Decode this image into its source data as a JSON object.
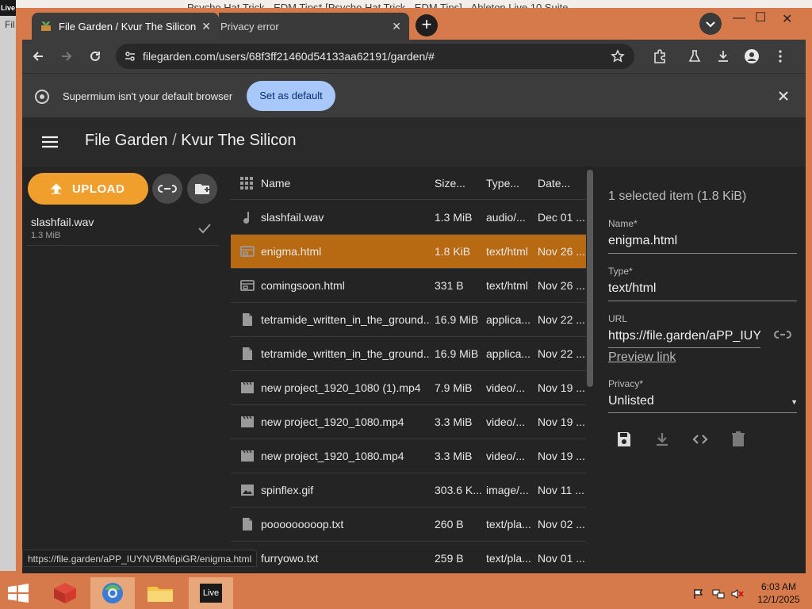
{
  "background": {
    "window_title": "Psycho Hat Trick - EDM Tips* [Psycho Hat Trick - EDM Tips] - Ableton Live 10 Suite",
    "live_label": "Live",
    "left_menu_hint": "Fil"
  },
  "browser": {
    "tabs": [
      {
        "label": "File Garden / Kvur The Silicon",
        "active": true
      },
      {
        "label": "Privacy error",
        "active": false
      }
    ],
    "address": "filegarden.com/users/68f3ff21460d54133aa62191/garden/#",
    "infobar": {
      "message": "Supermium isn't your default browser",
      "button": "Set as default"
    },
    "status_url": "https://file.garden/aPP_IUYNVBM6piGR/enigma.html"
  },
  "app": {
    "title": "File Garden",
    "separator": "/",
    "user": "Kvur The Silicon",
    "upload_label": "UPLOAD",
    "upload_queue": [
      {
        "name": "slashfail.wav",
        "size": "1.3 MiB"
      }
    ],
    "columns": {
      "name": "Name",
      "size": "Size...",
      "type": "Type...",
      "date": "Date..."
    },
    "files": [
      {
        "icon": "audio-icon",
        "name": "slashfail.wav",
        "size": "1.3 MiB",
        "type": "audio/...",
        "date": "Dec 01 ...",
        "selected": false
      },
      {
        "icon": "web-icon",
        "name": "enigma.html",
        "size": "1.8 KiB",
        "type": "text/html",
        "date": "Nov 26 ...",
        "selected": true
      },
      {
        "icon": "web-icon",
        "name": "comingsoon.html",
        "size": "331 B",
        "type": "text/html",
        "date": "Nov 26 ...",
        "selected": false
      },
      {
        "icon": "file-icon",
        "name": "tetramide_written_in_the_ground...",
        "size": "16.9 MiB",
        "type": "applica...",
        "date": "Nov 22 ...",
        "selected": false
      },
      {
        "icon": "file-icon",
        "name": "tetramide_written_in_the_ground...",
        "size": "16.9 MiB",
        "type": "applica...",
        "date": "Nov 22 ...",
        "selected": false
      },
      {
        "icon": "video-icon",
        "name": "new project_1920_1080 (1).mp4",
        "size": "7.9 MiB",
        "type": "video/...",
        "date": "Nov 19 ...",
        "selected": false
      },
      {
        "icon": "video-icon",
        "name": "new project_1920_1080.mp4",
        "size": "3.3 MiB",
        "type": "video/...",
        "date": "Nov 19 ...",
        "selected": false
      },
      {
        "icon": "video-icon",
        "name": "new project_1920_1080.mp4",
        "size": "3.3 MiB",
        "type": "video/...",
        "date": "Nov 19 ...",
        "selected": false
      },
      {
        "icon": "image-icon",
        "name": "spinflex.gif",
        "size": "303.6 K...",
        "type": "image/...",
        "date": "Nov 11 ...",
        "selected": false
      },
      {
        "icon": "file-icon",
        "name": "pooooooooop.txt",
        "size": "260 B",
        "type": "text/pla...",
        "date": "Nov 02 ...",
        "selected": false
      },
      {
        "icon": "file-icon",
        "name": "furryowo.txt",
        "size": "259 B",
        "type": "text/pla...",
        "date": "Nov 01 ...",
        "selected": false
      }
    ],
    "details": {
      "summary": "1 selected item (1.8 KiB)",
      "name_label": "Name*",
      "name_value": "enigma.html",
      "type_label": "Type*",
      "type_value": "text/html",
      "url_label": "URL",
      "url_value": "https://file.garden/aPP_IUYNVBM6piGR/enigma.html",
      "preview_link": "Preview link",
      "privacy_label": "Privacy*",
      "privacy_value": "Unlisted"
    }
  },
  "taskbar": {
    "live_label": "Live",
    "time": "6:03 AM",
    "date": "12/1/2025"
  },
  "colors": {
    "accent_orange": "#f09f2c",
    "selected_row": "#b86a12",
    "frame": "#d77a4b",
    "set_default_button": "#a8c7fa"
  }
}
